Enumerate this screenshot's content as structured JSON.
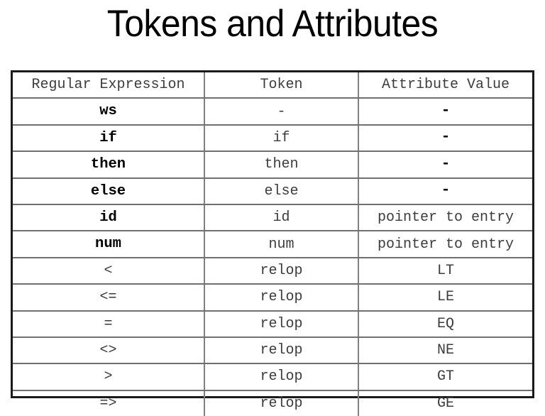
{
  "slide": {
    "title": "Tokens and Attributes"
  },
  "table": {
    "headers": {
      "regular_expression": "Regular Expression",
      "token": "Token",
      "attribute_value": "Attribute Value"
    },
    "rows": [
      {
        "regex": "ws",
        "token": "-",
        "attribute": "-"
      },
      {
        "regex": "if",
        "token": "if",
        "attribute": "-"
      },
      {
        "regex": "then",
        "token": "then",
        "attribute": "-"
      },
      {
        "regex": "else",
        "token": "else",
        "attribute": "-"
      },
      {
        "regex": "id",
        "token": "id",
        "attribute": "pointer to entry"
      },
      {
        "regex": "num",
        "token": "num",
        "attribute": "pointer to entry"
      },
      {
        "regex": "<",
        "token": "relop",
        "attribute": "LT"
      },
      {
        "regex": "<=",
        "token": "relop",
        "attribute": "LE"
      },
      {
        "regex": "=",
        "token": "relop",
        "attribute": "EQ"
      },
      {
        "regex": "<>",
        "token": "relop",
        "attribute": "NE"
      },
      {
        "regex": ">",
        "token": "relop",
        "attribute": "GT"
      },
      {
        "regex": "=>",
        "token": "relop",
        "attribute": "GE"
      }
    ]
  },
  "colors": {
    "background": "#ffffff",
    "text": "#000000",
    "outer_border": "#1a1a1a",
    "grid_line": "#808080",
    "muted_text": "#3c3c3c"
  }
}
